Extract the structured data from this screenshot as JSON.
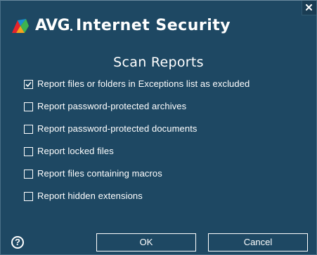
{
  "titlebar": {
    "brand": "AVG",
    "product": "Internet Security",
    "close_icon": "close-icon",
    "logo_colors": [
      "#e8232b",
      "#f7a21b",
      "#3eb34f",
      "#1a8ed0"
    ]
  },
  "dialog": {
    "heading": "Scan Reports"
  },
  "options": [
    {
      "label": "Report files or folders in Exceptions list as excluded",
      "checked": true
    },
    {
      "label": "Report password-protected archives",
      "checked": false
    },
    {
      "label": "Report password-protected documents",
      "checked": false
    },
    {
      "label": "Report locked files",
      "checked": false
    },
    {
      "label": "Report files containing macros",
      "checked": false
    },
    {
      "label": "Report hidden extensions",
      "checked": false
    }
  ],
  "footer": {
    "help_glyph": "?",
    "ok_label": "OK",
    "cancel_label": "Cancel"
  },
  "colors": {
    "background": "#1e4863",
    "text": "#ffffff"
  }
}
